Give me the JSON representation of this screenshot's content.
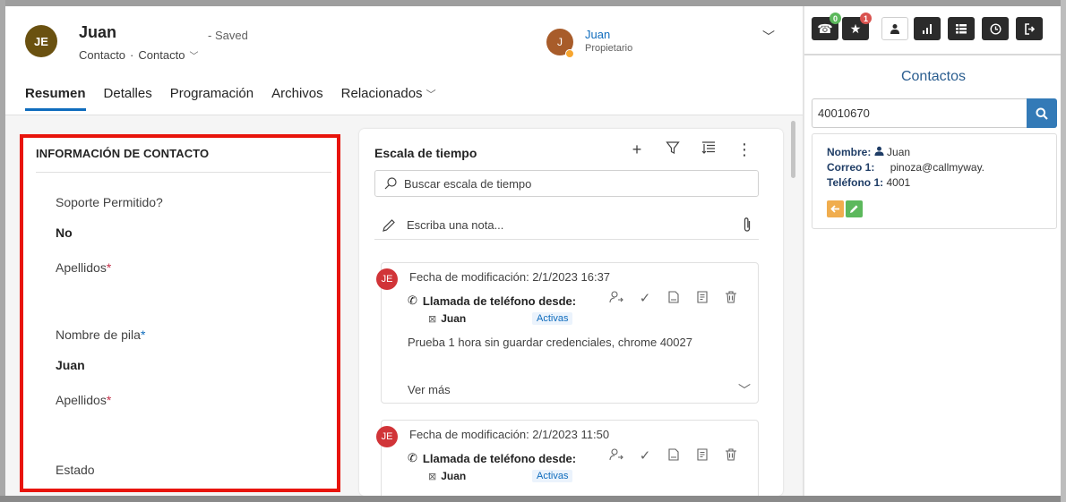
{
  "record": {
    "avatar_initials": "JE",
    "name": "Juan",
    "saved_status": "- Saved",
    "entity": "Contacto",
    "form": "Contacto",
    "owner_initial": "J",
    "owner_name": "Juan",
    "owner_role": "Propietario"
  },
  "tabs": [
    "Resumen",
    "Detalles",
    "Programación",
    "Archivos",
    "Relacionados"
  ],
  "contact_info": {
    "title": "INFORMACIÓN DE CONTACTO",
    "fields": [
      {
        "label": "Soporte Permitido?",
        "value": "No"
      },
      {
        "label": "Apellidos",
        "required": "*",
        "value": ""
      },
      {
        "label": "Nombre de pila",
        "required": "*",
        "value": "Juan"
      },
      {
        "label": "Apellidos",
        "required": "*",
        "value": ""
      },
      {
        "label": "Estado",
        "value": ""
      }
    ]
  },
  "timeline": {
    "title": "Escala de tiempo",
    "search_placeholder": "Buscar escala de tiempo",
    "note_placeholder": "Escriba una nota...",
    "posts": [
      {
        "initials": "JE",
        "date": "Fecha de modificación: 2/1/2023 16:37",
        "type": "Llamada de teléfono desde:",
        "who": "Juan",
        "status": "Activas",
        "body": "Prueba 1 hora sin guardar credenciales, chrome 40027",
        "more": "Ver más"
      },
      {
        "initials": "JE",
        "date": "Fecha de modificación: 2/1/2023 11:50",
        "type": "Llamada de teléfono desde:",
        "who": "Juan",
        "status": "Activas"
      }
    ]
  },
  "softphone": {
    "badges": {
      "calls": "0",
      "favorites": "1"
    },
    "title": "Contactos",
    "search_value": "40010670",
    "contact": {
      "name_label": "Nombre:",
      "name": "Juan",
      "email_label": "Correo 1:",
      "email": "pinoza@callmyway.",
      "phone_label": "Teléfono 1:",
      "phone": "4001"
    },
    "colors": {
      "badge_green": "#5cb85c",
      "badge_red": "#d9534f",
      "btn_orange": "#f0ad4e",
      "btn_green": "#5cb85c",
      "search_blue": "#337ab7"
    }
  },
  "colors": {
    "highlight_border": "#e8140b",
    "accent": "#0f6cbd"
  }
}
